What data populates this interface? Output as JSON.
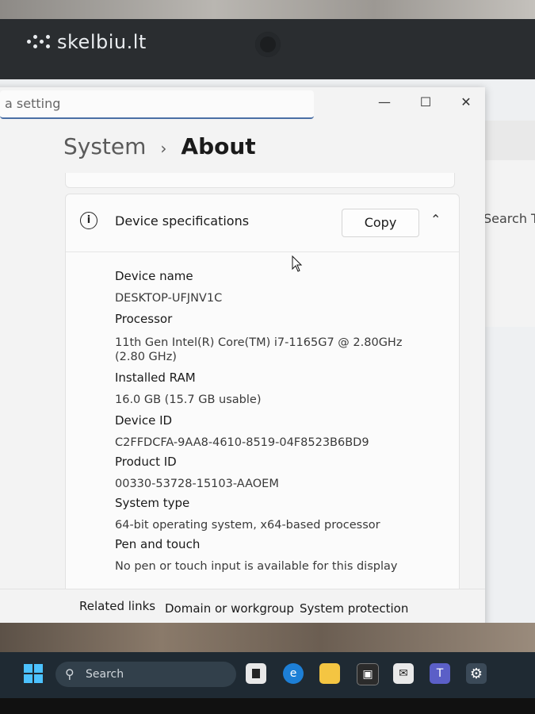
{
  "brand": {
    "name": "skelbiu.lt"
  },
  "settings_window": {
    "search_placeholder": "a setting",
    "controls": {
      "minimize": "—",
      "maximize": "☐",
      "close": "✕"
    },
    "breadcrumb": {
      "parent": "System",
      "separator": "›",
      "current": "About"
    }
  },
  "background_window": {
    "search_text": "Search Th"
  },
  "device_specs": {
    "title": "Device specifications",
    "copy_label": "Copy",
    "collapse_icon": "chevron-up-icon",
    "items": [
      {
        "label": "Device name",
        "value": "DESKTOP-UFJNV1C"
      },
      {
        "label": "Processor",
        "value": "11th Gen Intel(R) Core(TM) i7-1165G7 @ 2.80GHz (2.80 GHz)"
      },
      {
        "label": "Installed RAM",
        "value": "16.0 GB (15.7 GB usable)"
      },
      {
        "label": "Device ID",
        "value": "C2FFDCFA-9AA8-4610-8519-04F8523B6BD9"
      },
      {
        "label": "Product ID",
        "value": "00330-53728-15103-AAOEM"
      },
      {
        "label": "System type",
        "value": "64-bit operating system, x64-based processor"
      },
      {
        "label": "Pen and touch",
        "value": "No pen or touch input is available for this display"
      }
    ]
  },
  "related_links": {
    "title": "Related links",
    "links": [
      "Domain or workgroup",
      "System protection"
    ]
  },
  "taskbar": {
    "search_label": "Search",
    "apps": [
      "task-view-icon",
      "edge-icon",
      "file-explorer-icon",
      "store-icon",
      "mail-icon",
      "teams-icon",
      "settings-icon"
    ]
  },
  "colors": {
    "accent": "#4a6fa5",
    "taskbar": "#1f2a33",
    "start": "#4cc2ff"
  }
}
